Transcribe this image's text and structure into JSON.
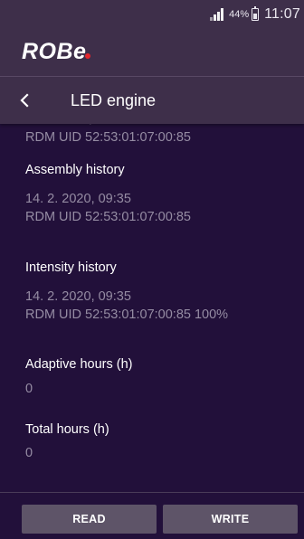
{
  "status_bar": {
    "battery_percent": "44%",
    "time": "11:07"
  },
  "brand": {
    "logo_text": "ROBe"
  },
  "header": {
    "title": "LED engine"
  },
  "content": {
    "partial_top_value": "14. 2. 2020, 09:35",
    "top_uid": "RDM UID 52:53:01:07:00:85",
    "assembly": {
      "label": "Assembly history",
      "date": "14. 2. 2020, 09:35",
      "uid": "RDM UID 52:53:01:07:00:85"
    },
    "intensity": {
      "label": "Intensity history",
      "date": "14. 2. 2020, 09:35",
      "uid": "RDM UID 52:53:01:07:00:85 100%"
    },
    "adaptive_hours": {
      "label": "Adaptive hours (h)",
      "value": "0"
    },
    "total_hours": {
      "label": "Total hours (h)",
      "value": "0"
    }
  },
  "actions": {
    "read_label": "READ",
    "write_label": "WRITE"
  },
  "colors": {
    "background": "#22103a",
    "bar": "#3e2f4a",
    "button": "#5e5468",
    "logo_dot": "#e3262d"
  }
}
